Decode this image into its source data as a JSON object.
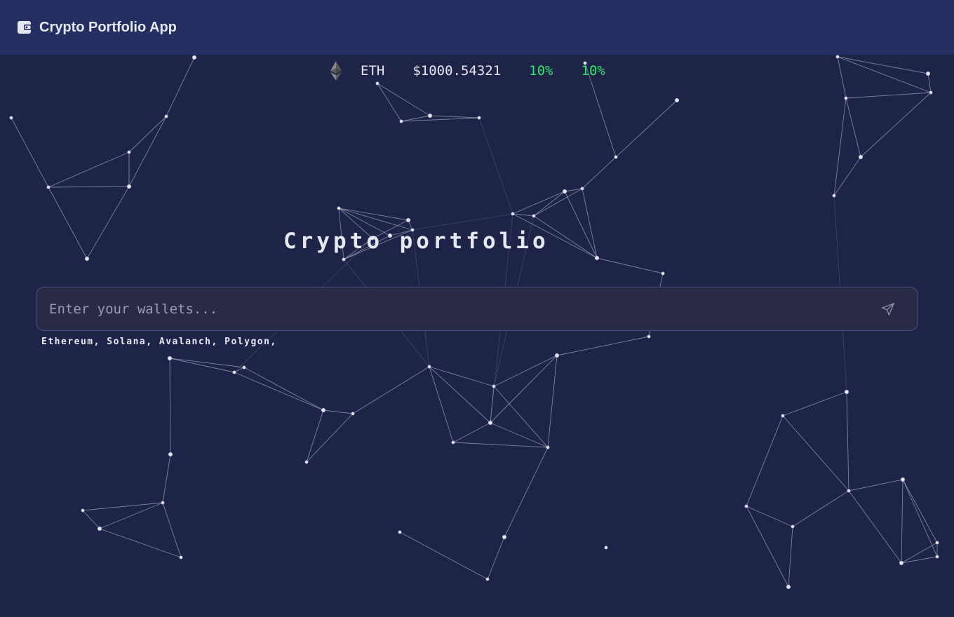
{
  "header": {
    "app_title": "Crypto Portfolio App",
    "logo_icon": "wallet-icon"
  },
  "ticker": {
    "icon": "ethereum-icon",
    "symbol": "ETH",
    "price": "$1000.54321",
    "change_1": "10%",
    "change_2": "10%",
    "positive_color": "#2ee86b"
  },
  "hero": {
    "title": "Crypto portfolio"
  },
  "search": {
    "placeholder": "Enter your wallets...",
    "value": "",
    "submit_icon": "send-icon"
  },
  "networks_hint": "Ethereum, Solana, Avalanch, Polygon,",
  "colors": {
    "background": "#1e2447",
    "header": "#262f62",
    "input_background": "#292b46",
    "text": "#e6e8f0"
  }
}
